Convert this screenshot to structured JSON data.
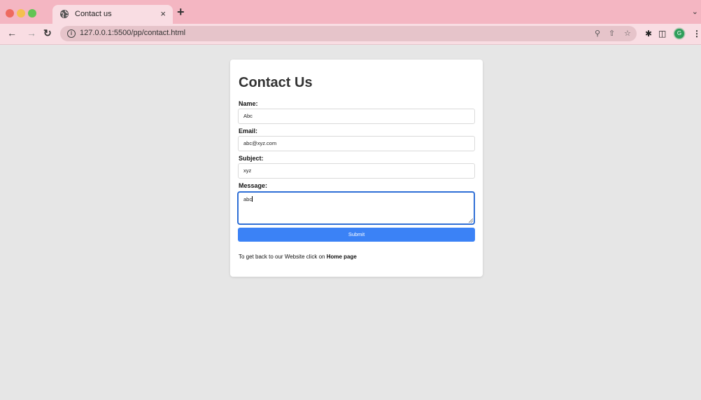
{
  "browser": {
    "tab_title": "Contact us",
    "tab_close": "×",
    "new_tab": "+",
    "url": "127.0.0.1:5500/pp/contact.html",
    "traffic_colors": [
      "#ee6a5f",
      "#f5c04f",
      "#61c454"
    ],
    "profile_initial": "G",
    "icons": [
      "back-icon",
      "forward-icon",
      "reload-icon",
      "info-icon",
      "zoom-icon",
      "share-icon",
      "bookmark-star-icon",
      "extensions-icon",
      "side-panel-icon",
      "profile-avatar",
      "kebab-menu-icon"
    ]
  },
  "page": {
    "heading": "Contact Us",
    "fields": [
      {
        "label": "Name:",
        "value": "Abc"
      },
      {
        "label": "Email:",
        "value": "abc@xyz.com"
      },
      {
        "label": "Subject:",
        "value": "xyz"
      }
    ],
    "message": {
      "label": "Message:",
      "value": "abc"
    },
    "submit_label": "Submit",
    "footer_text": "To get back to our Website click on ",
    "footer_link": "Home page",
    "accent_color": "#3b82f6"
  }
}
